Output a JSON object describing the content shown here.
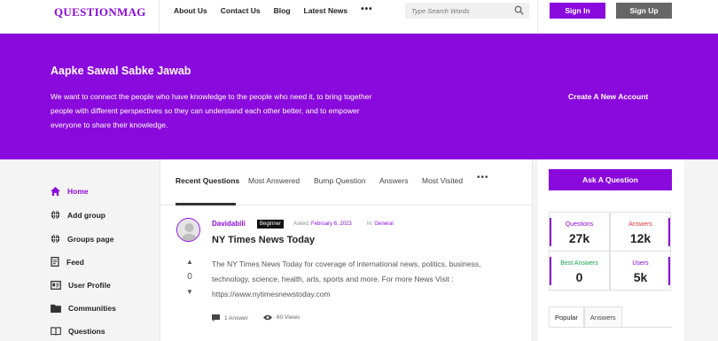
{
  "header": {
    "logo": "QUESTIONMAG",
    "nav": [
      "About Us",
      "Contact Us",
      "Blog",
      "Latest News"
    ],
    "more": "•••",
    "search_placeholder": "Type Search Words",
    "signin": "Sign In",
    "signup": "Sign Up"
  },
  "hero": {
    "title": "Aapke Sawal Sabke Jawab",
    "text": "We want to connect the people who have knowledge to the people who need it, to bring together people with different perspectives so they can understand each other better, and to empower everyone to share their knowledge.",
    "cta": "Create A New Account"
  },
  "sidebar": {
    "items": [
      {
        "label": "Home",
        "icon": "home-icon"
      },
      {
        "label": "Add group",
        "icon": "globe-icon"
      },
      {
        "label": "Groups page",
        "icon": "globe-icon"
      },
      {
        "label": "Feed",
        "icon": "feed-icon"
      },
      {
        "label": "User Profile",
        "icon": "profile-icon"
      },
      {
        "label": "Communities",
        "icon": "folder-icon"
      },
      {
        "label": "Questions",
        "icon": "book-icon"
      }
    ]
  },
  "main": {
    "tabs": [
      "Recent Questions",
      "Most Answered",
      "Bump Question",
      "Answers",
      "Most Visited"
    ],
    "more": "•••",
    "question": {
      "author": "Davidabili",
      "badge": "Beginner",
      "asked_label": "Asked:",
      "asked_date": "February 6, 2023",
      "in_label": "In:",
      "category": "General",
      "title": "NY Times News Today",
      "votes": "0",
      "body": "The NY Times News Today for coverage of international news, politics, business, technology, science, health, arts, sports and more. For more News Visit : https://www.nytimesnewstoday.com",
      "answers": "1 Answer",
      "views": "60 Views"
    }
  },
  "right": {
    "ask": "Ask A Question",
    "stats": [
      {
        "label": "Questions",
        "value": "27k",
        "color": "#8a09dd"
      },
      {
        "label": "Answers",
        "value": "12k",
        "color": "#e03a3a"
      },
      {
        "label": "Best Answers",
        "value": "0",
        "color": "#1aa44a"
      },
      {
        "label": "Users",
        "value": "5k",
        "color": "#8a09dd"
      }
    ],
    "tabs": [
      "Popular",
      "Answers"
    ]
  },
  "colors": {
    "accent": "#8a09dd",
    "secondary": "#666666"
  }
}
